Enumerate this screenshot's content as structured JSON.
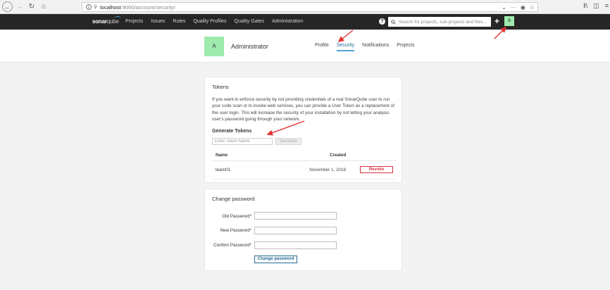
{
  "browser": {
    "url_host": "localhost",
    "url_path": ":9000/account/security/"
  },
  "nav": {
    "logo_main": "sonar",
    "logo_sub": "qube",
    "links": [
      "Projects",
      "Issues",
      "Rules",
      "Quality Profiles",
      "Quality Gates",
      "Administration"
    ],
    "search_placeholder": "Search for projects, sub-projects and files...",
    "avatar_letter": "A"
  },
  "account": {
    "avatar_letter": "A",
    "name": "Administrator",
    "tabs": [
      "Profile",
      "Security",
      "Notifications",
      "Projects"
    ],
    "active_tab": "Security"
  },
  "tokens": {
    "title": "Tokens",
    "description": "If you want to enforce security by not providing credentials of a real SonarQube user to run your code scan or to invoke web services, you can provide a User Token as a replacement of the user login. This will increase the security of your installation by not letting your analysis user's password going through your network.",
    "generate_title": "Generate Tokens",
    "input_placeholder": "Enter Token Name",
    "generate_label": "Generate",
    "columns": {
      "name": "Name",
      "created": "Created"
    },
    "rows": [
      {
        "name": "team01",
        "created": "November 1, 2018",
        "action": "Revoke"
      }
    ]
  },
  "password": {
    "title": "Change password",
    "old_label": "Old Password*",
    "new_label": "New Password*",
    "confirm_label": "Confirm Password*",
    "button_label": "Change password"
  },
  "colors": {
    "nav_bg": "#262626",
    "avatar_green": "#9eebad",
    "accent_blue": "#236a97",
    "revoke_red": "#d4333f",
    "annotation_red": "#e03030"
  }
}
